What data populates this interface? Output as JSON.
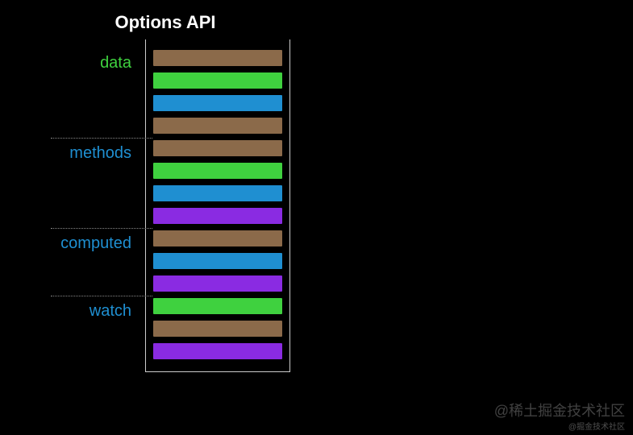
{
  "title": "Options API",
  "colors": {
    "brown": "#8b6a4a",
    "green": "#3fd13f",
    "blue": "#1f8fd1",
    "purple": "#8a2be2"
  },
  "label_colors": {
    "data": "#3fd13f",
    "methods": "#1f8fd1",
    "computed": "#1f8fd1",
    "watch": "#1f8fd1"
  },
  "sections": [
    {
      "name": "data",
      "bars": [
        "brown",
        "green",
        "blue",
        "brown"
      ]
    },
    {
      "name": "methods",
      "bars": [
        "brown",
        "green",
        "blue",
        "purple"
      ]
    },
    {
      "name": "computed",
      "bars": [
        "brown",
        "blue",
        "purple"
      ]
    },
    {
      "name": "watch",
      "bars": [
        "green",
        "brown",
        "purple"
      ]
    }
  ],
  "watermark": "@稀土掘金技术社区",
  "watermark_small": "@掘金技术社区"
}
